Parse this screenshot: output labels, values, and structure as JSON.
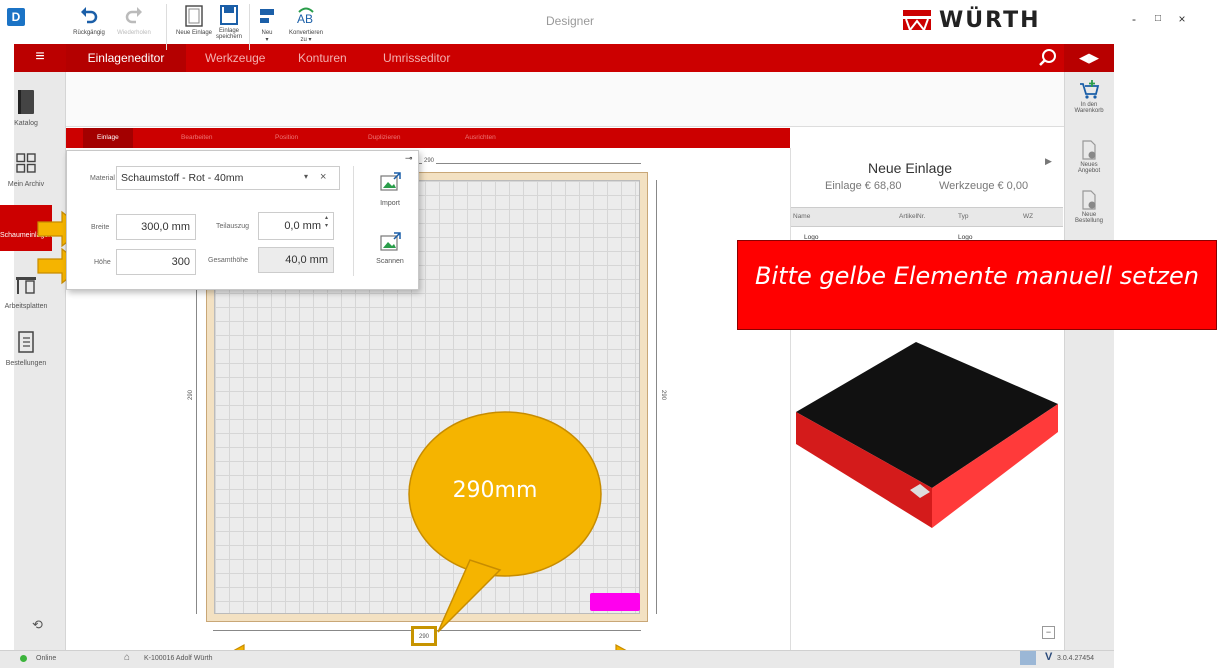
{
  "window": {
    "badge": "D",
    "title": "Designer",
    "brand": "WÜRTH",
    "minimize": "-",
    "maximize": "□",
    "close": "×"
  },
  "nav": {
    "menu_icon": "hamburger-icon",
    "tabs": [
      "Einlageneditor",
      "Werkzeuge",
      "Konturen",
      "Umrisseditor"
    ],
    "active_tab": "Einlageneditor",
    "search_icon": "search-icon",
    "toggle_icon": "expand-arrows-icon"
  },
  "sidebar": {
    "items": [
      {
        "label": "Katalog",
        "icon": "book-icon"
      },
      {
        "label": "Mein Archiv",
        "icon": "grid-icon"
      },
      {
        "label": "Schaumeinlagen",
        "icon": "foam-icon",
        "active": true
      },
      {
        "label": "Arbeitsplatten",
        "icon": "workbench-icon"
      },
      {
        "label": "Bestellungen",
        "icon": "clipboard-icon"
      }
    ],
    "bottom_icon": "refresh-icon"
  },
  "ribbon": {
    "undo": "Rückgängig",
    "redo": "Wiederholen",
    "new_insert": "Neue Einlage",
    "save_line1": "Einlage",
    "save_line2": "speichern",
    "new_line1": "Neu",
    "new_line2": "▾",
    "convert_line1": "Konvertieren",
    "convert_line2": "zu ▾"
  },
  "subtabs": {
    "items": [
      "Einlage",
      "Bearbeiten",
      "Position",
      "Duplizieren",
      "Ausrichten"
    ],
    "active": "Einlage"
  },
  "properties": {
    "material_label": "Material",
    "material_value": "Schaumstoff - Rot - 40mm",
    "breite_label": "Breite",
    "breite_value": "300,0 mm",
    "hoehe_label": "Höhe",
    "hoehe_value": "300",
    "teilauszug_label": "Teilauszug",
    "teilauszug_value": "0,0 mm",
    "gesamthoehe_label": "Gesamthöhe",
    "gesamthoehe_value": "40,0 mm",
    "import_label": "Import",
    "scan_label": "Scannen",
    "pin_icon": "pin-icon",
    "dropdown_icon": "chevron-down-icon",
    "clear_icon": "close-icon"
  },
  "canvas": {
    "dim_top": "290",
    "dim_left": "290",
    "dim_right": "290",
    "dim_bottom": "290"
  },
  "right_panel": {
    "title": "Neue Einlage",
    "price_insert": "Einlage € 68,80",
    "price_tools": "Werkzeuge € 0,00",
    "columns": [
      "Name",
      "ArtikelNr.",
      "Typ",
      "WZ"
    ],
    "rows": [
      {
        "name": "Logo",
        "artikel": "",
        "typ": "Logo",
        "wz": ""
      }
    ],
    "collapse_icon": "minus-icon"
  },
  "right_sidebar": {
    "items": [
      {
        "label_1": "In den",
        "label_2": "Warenkorb",
        "icon": "cart-icon"
      },
      {
        "label_1": "Neues",
        "label_2": "Angebot",
        "icon": "offer-doc-icon"
      },
      {
        "label_1": "Neue",
        "label_2": "Bestellung",
        "icon": "order-doc-icon"
      }
    ]
  },
  "annotations": {
    "banner": "Bitte gelbe Elemente manuell setzen",
    "bubble": "290mm"
  },
  "status": {
    "online": "Online",
    "user": "K-100016 Adolf Würth",
    "version": "3.0.4.27454"
  },
  "colors": {
    "brand_red": "#cc0000",
    "annotation_red": "#ff0000",
    "annotation_yellow": "#f5b400",
    "magenta_logo": "#ff00ee",
    "board_beige": "#f3e1c2"
  }
}
